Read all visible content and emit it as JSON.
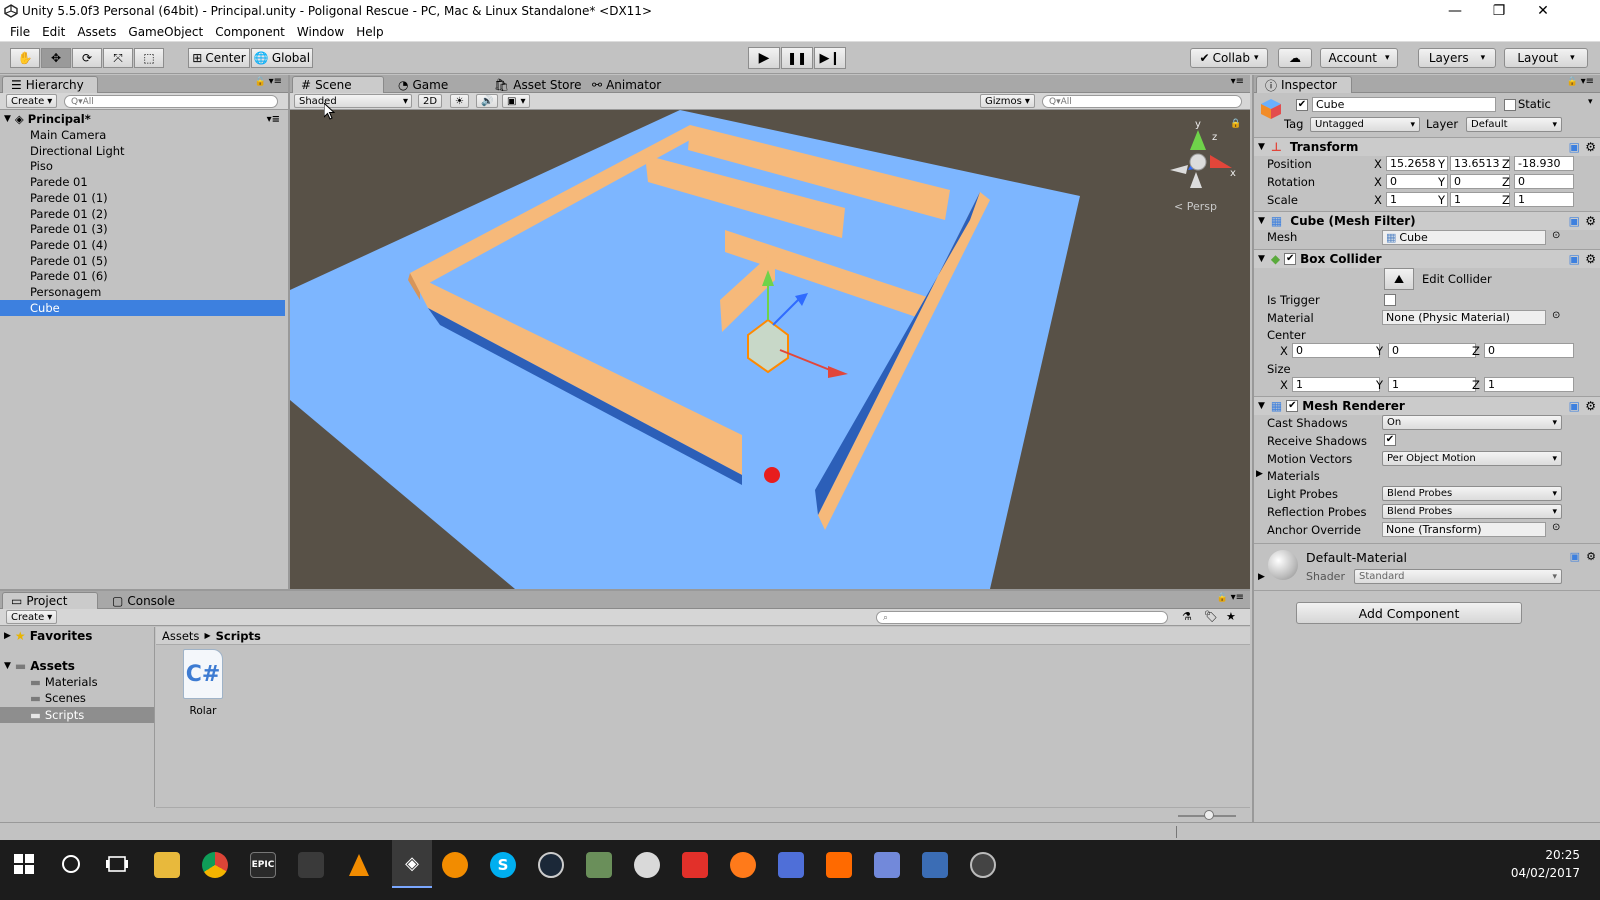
{
  "window": {
    "title": "Unity 5.5.0f3 Personal (64bit) - Principal.unity - Poligonal Rescue - PC, Mac & Linux Standalone* <DX11>",
    "minimize": "—",
    "maximize": "❐",
    "close": "✕"
  },
  "menu": [
    "File",
    "Edit",
    "Assets",
    "GameObject",
    "Component",
    "Window",
    "Help"
  ],
  "toolbar": {
    "pivot": "Center",
    "space": "Global",
    "collab": "Collab",
    "account": "Account",
    "layers": "Layers",
    "layout": "Layout"
  },
  "hierarchy": {
    "tab": "Hierarchy",
    "create": "Create",
    "search_placeholder": "Q▾All",
    "scene": "Principal*",
    "items": [
      "Main Camera",
      "Directional Light",
      "Piso",
      "Parede 01",
      "Parede 01 (1)",
      "Parede 01 (2)",
      "Parede 01 (3)",
      "Parede 01 (4)",
      "Parede 01 (5)",
      "Parede 01 (6)",
      "Personagem",
      "Cube"
    ],
    "selected_index": 11
  },
  "scene_view": {
    "tabs": [
      "Scene",
      "Game",
      "Asset Store",
      "Animator"
    ],
    "shading": "Shaded",
    "mode_2d": "2D",
    "gizmos": "Gizmos",
    "search_placeholder": "Q▾All",
    "persp": "< Persp",
    "axes": {
      "x": "x",
      "y": "y",
      "z": "z"
    },
    "colors": {
      "sky": "#585147",
      "floor": "#7db6ff",
      "wall": "#f6b97a",
      "wall_side": "#2c5fb8"
    }
  },
  "project": {
    "tabs": [
      "Project",
      "Console"
    ],
    "create": "Create",
    "tree": {
      "favorites": "Favorites",
      "assets": "Assets",
      "children": [
        "Materials",
        "Scenes",
        "Scripts"
      ],
      "selected": "Scripts"
    },
    "breadcrumb": [
      "Assets",
      "Scripts"
    ],
    "files": [
      {
        "name": "Rolar",
        "icon": "C#"
      }
    ]
  },
  "inspector": {
    "tab": "Inspector",
    "object_name": "Cube",
    "static_label": "Static",
    "tag_label": "Tag",
    "tag": "Untagged",
    "layer_label": "Layer",
    "layer": "Default",
    "transform": {
      "title": "Transform",
      "position_label": "Position",
      "rotation_label": "Rotation",
      "scale_label": "Scale",
      "position": {
        "x": "15.2658",
        "y": "13.6513",
        "z": "-18.930"
      },
      "rotation": {
        "x": "0",
        "y": "0",
        "z": "0"
      },
      "scale": {
        "x": "1",
        "y": "1",
        "z": "1"
      }
    },
    "mesh_filter": {
      "title": "Cube (Mesh Filter)",
      "mesh_label": "Mesh",
      "mesh": "Cube"
    },
    "box_collider": {
      "title": "Box Collider",
      "edit": "Edit Collider",
      "is_trigger_label": "Is Trigger",
      "material_label": "Material",
      "material": "None (Physic Material)",
      "center_label": "Center",
      "center": {
        "x": "0",
        "y": "0",
        "z": "0"
      },
      "size_label": "Size",
      "size": {
        "x": "1",
        "y": "1",
        "z": "1"
      }
    },
    "mesh_renderer": {
      "title": "Mesh Renderer",
      "cast_shadows_label": "Cast Shadows",
      "cast_shadows": "On",
      "receive_shadows_label": "Receive Shadows",
      "motion_vectors_label": "Motion Vectors",
      "motion_vectors": "Per Object Motion",
      "materials_label": "Materials",
      "light_probes_label": "Light Probes",
      "light_probes": "Blend Probes",
      "reflection_probes_label": "Reflection Probes",
      "reflection_probes": "Blend Probes",
      "anchor_override_label": "Anchor Override",
      "anchor_override": "None (Transform)"
    },
    "material": {
      "name": "Default-Material",
      "shader_label": "Shader",
      "shader": "Standard"
    },
    "add_component": "Add Component",
    "axis": {
      "x": "X",
      "y": "Y",
      "z": "Z"
    }
  },
  "taskbar": {
    "time": "20:25",
    "date": "04/02/2017"
  }
}
